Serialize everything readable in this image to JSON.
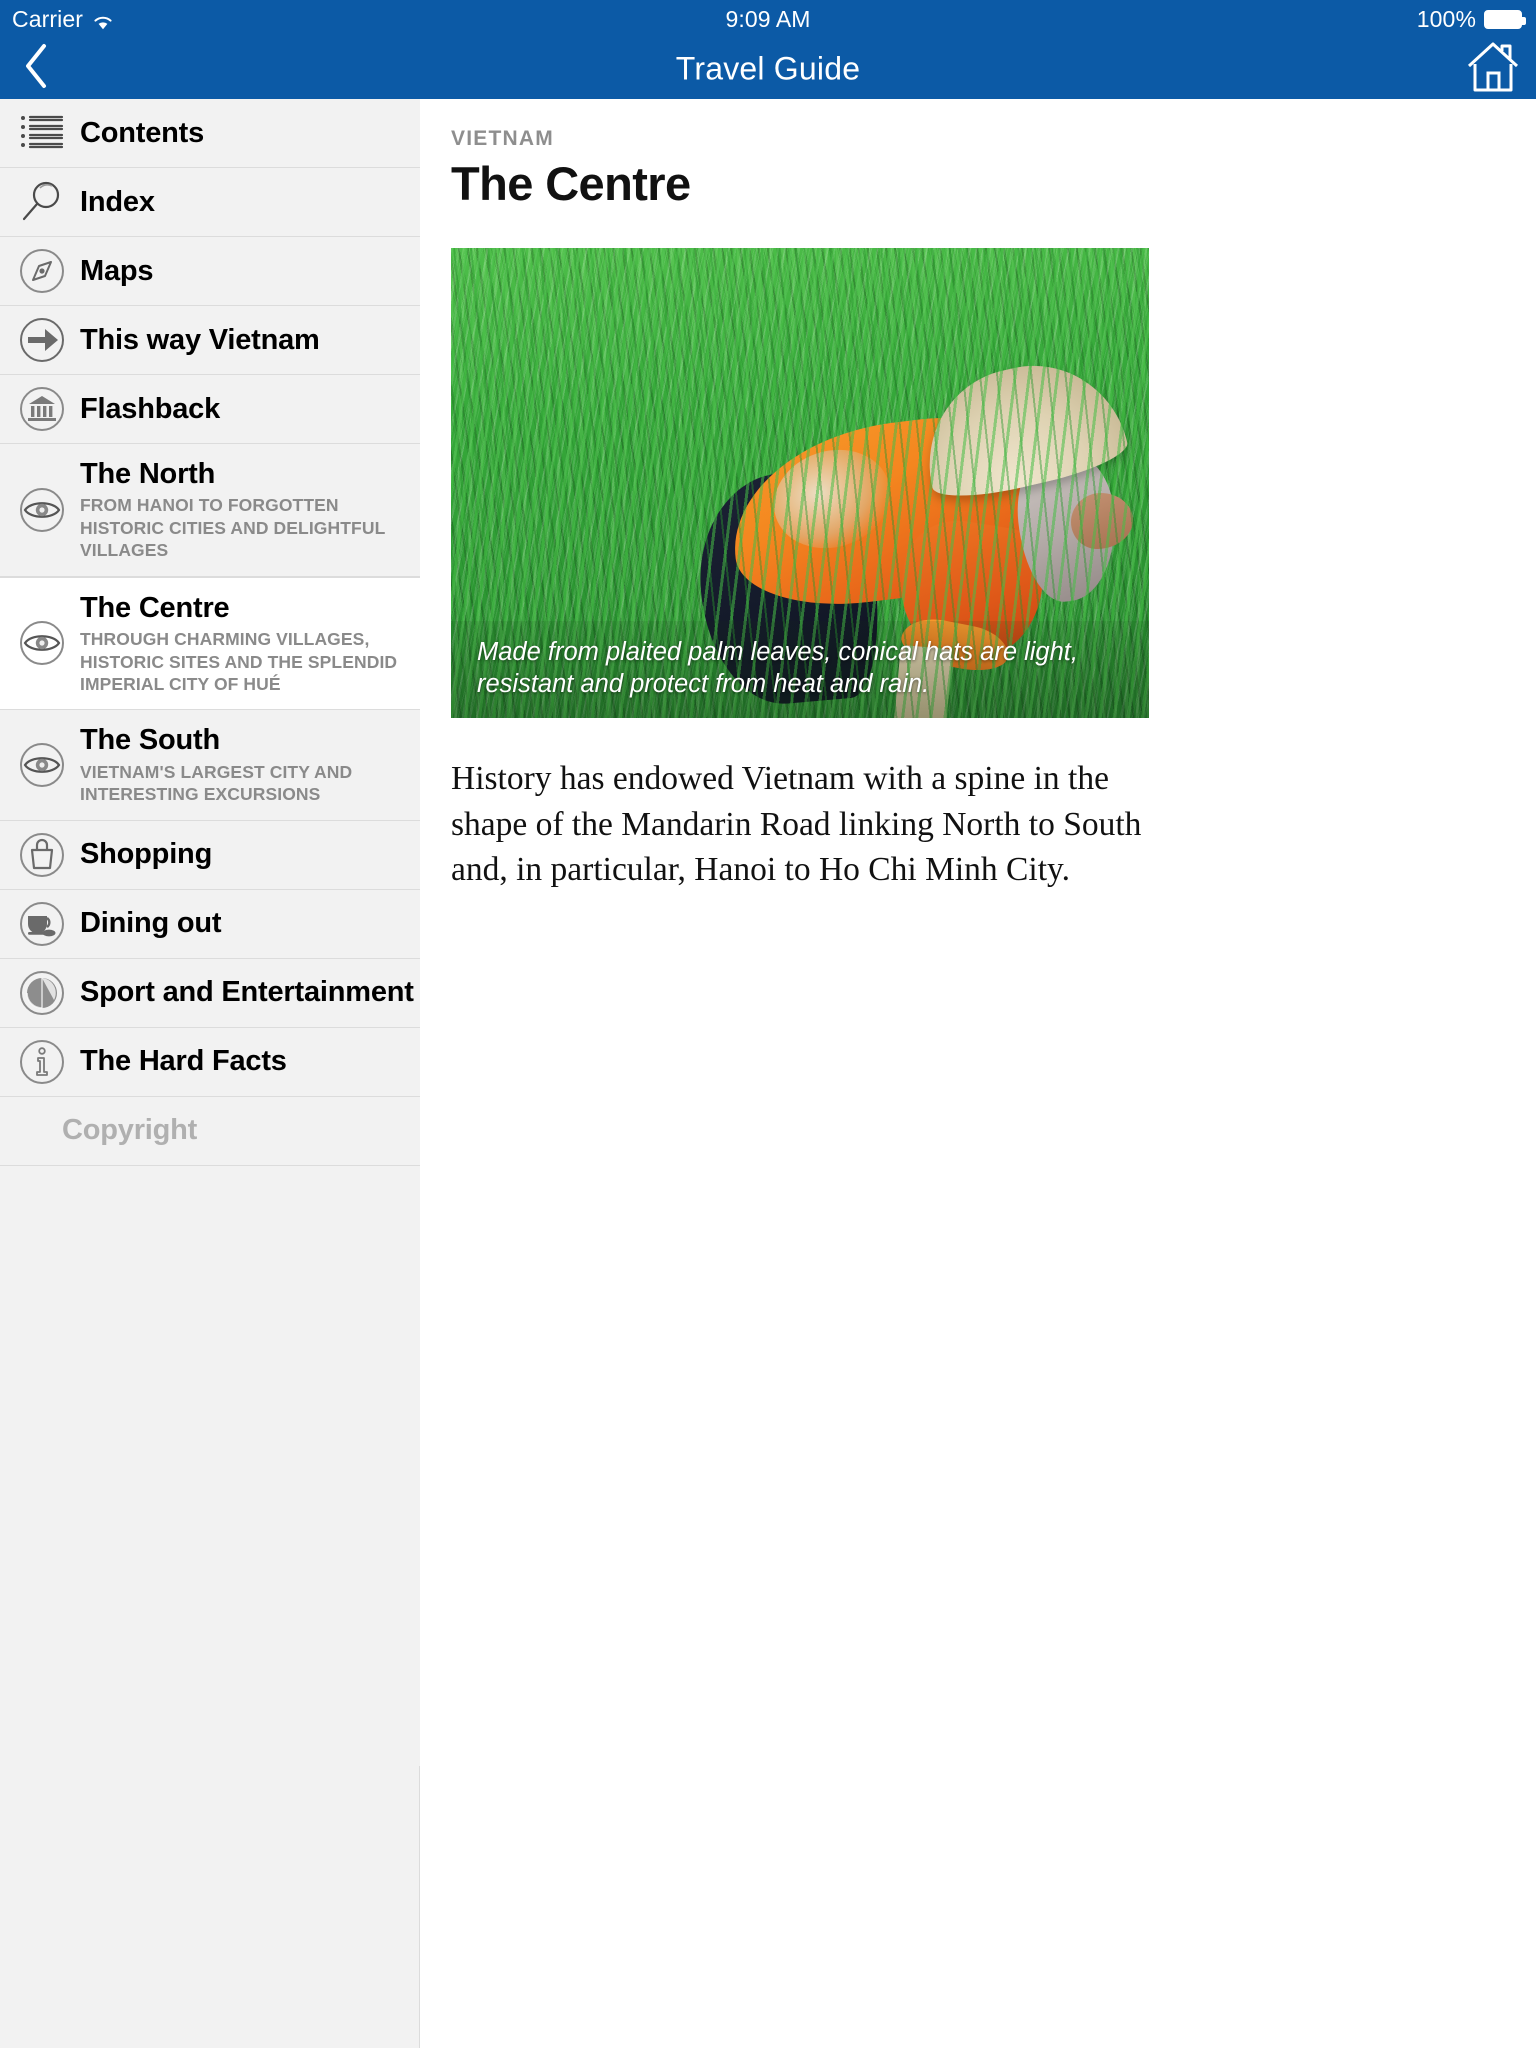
{
  "status_bar": {
    "carrier": "Carrier",
    "wifi_icon": "wifi-icon",
    "time": "9:09 AM",
    "battery_percent": "100%",
    "battery_icon": "battery-full-icon"
  },
  "nav_bar": {
    "back_icon": "chevron-left-icon",
    "title": "Travel Guide",
    "home_icon": "home-icon"
  },
  "sidebar": {
    "items": [
      {
        "label": "Contents",
        "subtitle": "",
        "icon": "list-icon",
        "selected": false,
        "muted": false
      },
      {
        "label": "Index",
        "subtitle": "",
        "icon": "magnifier-icon",
        "selected": false,
        "muted": false
      },
      {
        "label": "Maps",
        "subtitle": "",
        "icon": "compass-icon",
        "selected": false,
        "muted": false
      },
      {
        "label": "This way Vietnam",
        "subtitle": "",
        "icon": "arrow-right-circle-icon",
        "selected": false,
        "muted": false
      },
      {
        "label": "Flashback",
        "subtitle": "",
        "icon": "museum-icon",
        "selected": false,
        "muted": false
      },
      {
        "label": "The North",
        "subtitle": "FROM HANOI TO FORGOTTEN HISTORIC CITIES AND DELIGHTFUL VILLAGES",
        "icon": "eye-icon",
        "selected": false,
        "muted": false
      },
      {
        "label": "The Centre",
        "subtitle": "THROUGH CHARMING VILLAGES, HISTORIC SITES AND THE SPLENDID IMPERIAL CITY OF HUÉ",
        "icon": "eye-icon",
        "selected": true,
        "muted": false
      },
      {
        "label": "The South",
        "subtitle": "VIETNAM'S LARGEST CITY AND INTERESTING EXCURSIONS",
        "icon": "eye-icon",
        "selected": false,
        "muted": false
      },
      {
        "label": "Shopping",
        "subtitle": "",
        "icon": "shopping-bag-icon",
        "selected": false,
        "muted": false
      },
      {
        "label": "Dining out",
        "subtitle": "",
        "icon": "cup-spoon-icon",
        "selected": false,
        "muted": false
      },
      {
        "label": "Sport and Entertainment",
        "subtitle": "",
        "icon": "beach-ball-icon",
        "selected": false,
        "muted": false
      },
      {
        "label": "The Hard Facts",
        "subtitle": "",
        "icon": "info-icon",
        "selected": false,
        "muted": false
      },
      {
        "label": "Copyright",
        "subtitle": "",
        "icon": "",
        "selected": false,
        "muted": true
      }
    ]
  },
  "content": {
    "kicker": "VIETNAM",
    "headline": "The Centre",
    "figure": {
      "image_alt": "rice-field-farmer-photo",
      "caption": "Made from plaited palm leaves, conical hats are light, resistant and protect from heat and rain."
    },
    "paragraph": "History has endowed Vietnam with a spine in the shape of the Mandarin Road linking North to South and, in particular, Hanoi to Ho Chi Minh City."
  },
  "colors": {
    "nav_blue": "#0c5aa6",
    "sidebar_bg": "#f2f2f2",
    "selected_bg": "#ffffff",
    "divider": "#dcdcdc",
    "subtitle_gray": "#8a8a8a",
    "muted_text": "#b0b0b0"
  }
}
